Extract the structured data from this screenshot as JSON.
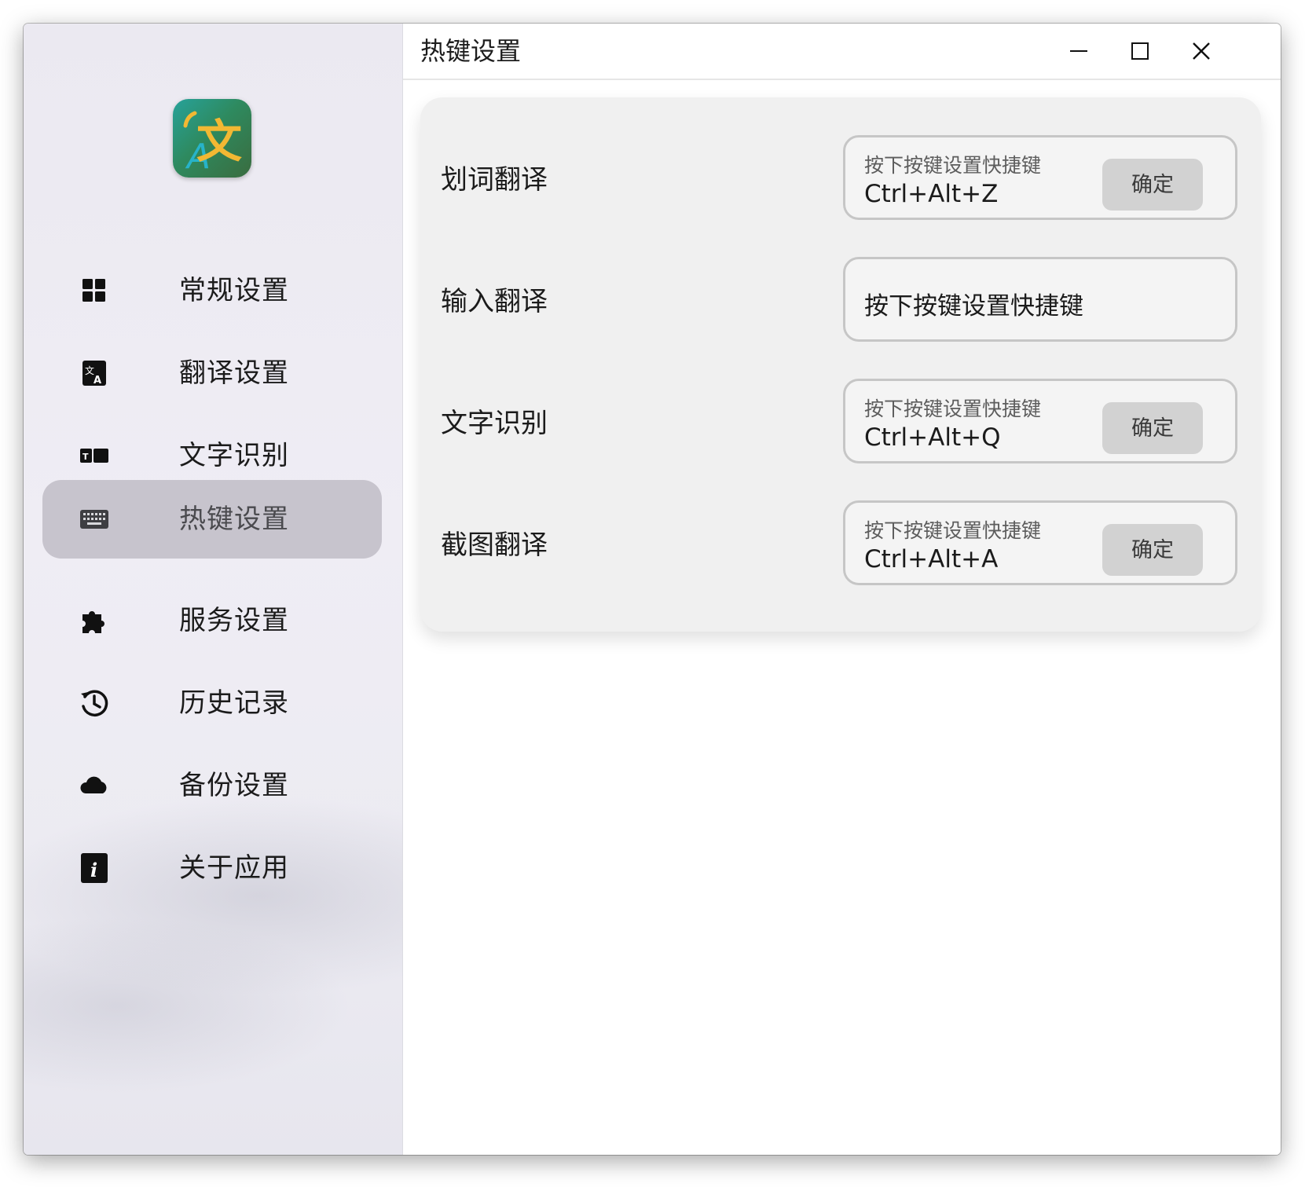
{
  "window": {
    "title": "热键设置",
    "controls": {
      "minimize": "minimize-icon",
      "maximize": "maximize-icon",
      "close": "close-icon"
    }
  },
  "sidebar": {
    "logo": {
      "letter_a": "A",
      "letter_wen": "文"
    },
    "items": [
      {
        "label": "常规设置",
        "icon": "grid-icon",
        "active": false
      },
      {
        "label": "翻译设置",
        "icon": "translate-icon",
        "active": false
      },
      {
        "label": "文字识别",
        "icon": "ocr-icon",
        "active": false
      },
      {
        "label": "热键设置",
        "icon": "keyboard-icon",
        "active": true
      },
      {
        "label": "服务设置",
        "icon": "puzzle-icon",
        "active": false
      },
      {
        "label": "历史记录",
        "icon": "history-icon",
        "active": false
      },
      {
        "label": "备份设置",
        "icon": "cloud-icon",
        "active": false
      },
      {
        "label": "关于应用",
        "icon": "info-icon",
        "active": false
      }
    ]
  },
  "hotkeys": [
    {
      "label": "划词翻译",
      "placeholder": "按下按键设置快捷键",
      "value": "Ctrl+Alt+Z",
      "confirm": "确定"
    },
    {
      "label": "输入翻译",
      "placeholder": "按下按键设置快捷键",
      "value": "",
      "confirm": ""
    },
    {
      "label": "文字识别",
      "placeholder": "按下按键设置快捷键",
      "value": "Ctrl+Alt+Q",
      "confirm": "确定"
    },
    {
      "label": "截图翻译",
      "placeholder": "按下按键设置快捷键",
      "value": "Ctrl+Alt+A",
      "confirm": "确定"
    }
  ],
  "colors": {
    "active_nav_bg": "#bab7c0",
    "card_bg": "#f0f0f0",
    "button_bg": "#d2d2d2",
    "logo_gradient_start": "#27a29a",
    "logo_letter": "#f2b833"
  }
}
